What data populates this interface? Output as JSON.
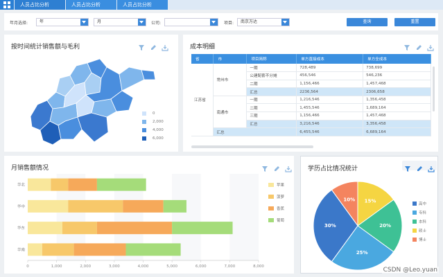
{
  "tabs": [
    "人员占比分析",
    "人员占比分析",
    "人员占比分析"
  ],
  "filters": {
    "year_label": "年月选择:",
    "year_value": "年",
    "month_value": "月",
    "company_label": "公司:",
    "company_value": "",
    "project_label": "项目:",
    "project_value": "南京万达",
    "query_label": "查询",
    "reset_label": "重置"
  },
  "map_panel": {
    "title": "按时间统计销售额与毛利",
    "legend": [
      "0",
      "2,000",
      "4,000",
      "6,000"
    ],
    "legend_colors": [
      "#cfe3fb",
      "#7fb6ec",
      "#4a8ede",
      "#1e5fb8"
    ]
  },
  "table_panel": {
    "title": "成本明细",
    "headers": [
      "省",
      "市",
      "项目简称",
      "单方直接成本",
      "单方全成本"
    ],
    "province": "江苏省",
    "rows": [
      {
        "city": "常州市",
        "name": "一期",
        "direct": "728,489",
        "full": "738,699",
        "hl": false
      },
      {
        "city": "",
        "name": "公建配套不分摊",
        "direct": "456,546",
        "full": "546,236",
        "hl": false
      },
      {
        "city": "",
        "name": "二期",
        "direct": "1,156,466",
        "full": "1,457,468",
        "hl": false
      },
      {
        "city": "",
        "name": "汇总",
        "direct": "2236,564",
        "full": "2306,658",
        "hl": true
      },
      {
        "city": "南通市",
        "name": "一期",
        "direct": "1,216,546",
        "full": "1,356,458",
        "hl": false
      },
      {
        "city": "",
        "name": "二期",
        "direct": "1,455,546",
        "full": "1,689,164",
        "hl": false
      },
      {
        "city": "",
        "name": "三期",
        "direct": "1,156,466",
        "full": "1,457,468",
        "hl": false
      },
      {
        "city": "",
        "name": "汇总",
        "direct": "3,216,546",
        "full": "3,356,458",
        "hl": true
      }
    ],
    "total_label": "汇总",
    "total_direct": "6,455,546",
    "total_full": "6,689,164"
  },
  "bar_panel": {
    "title": "月销售额情况"
  },
  "pie_panel": {
    "title": "学历占比情况统计"
  },
  "chart_data": [
    {
      "type": "bar",
      "orientation": "horizontal",
      "stacked": true,
      "categories": [
        "华北",
        "华中",
        "华东",
        "华南"
      ],
      "series": [
        {
          "name": "苹果",
          "color": "#f9e79b",
          "values": [
            800,
            1400,
            1200,
            500
          ]
        },
        {
          "name": "菠萝",
          "color": "#f7c86a",
          "values": [
            600,
            1900,
            1200,
            1100
          ]
        },
        {
          "name": "香蕉",
          "color": "#f6a95a",
          "values": [
            1000,
            1400,
            2600,
            1800
          ]
        },
        {
          "name": "葡萄",
          "color": "#a5dc7a",
          "values": [
            1700,
            800,
            2100,
            1900
          ]
        }
      ],
      "xticks": [
        "0",
        "1,000",
        "2,000",
        "3,000",
        "4,000",
        "5,000",
        "6,000",
        "7,000",
        "8,000"
      ],
      "xlim": [
        0,
        8000
      ]
    },
    {
      "type": "pie",
      "labels": [
        "高中",
        "专科",
        "本科",
        "硕士",
        "博士"
      ],
      "values": [
        30,
        25,
        20,
        15,
        10
      ],
      "display": [
        "30%",
        "25%",
        "20%",
        "15%",
        "10%"
      ],
      "colors": [
        "#3b78c9",
        "#4aa8e0",
        "#3ec195",
        "#f5d542",
        "#f4845f"
      ]
    }
  ]
}
